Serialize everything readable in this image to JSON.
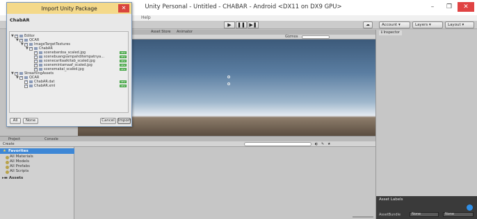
{
  "window": {
    "title": "Unity Personal - Untitled - CHABAR - Android <DX11 on DX9 GPU>",
    "minimize": "–",
    "maximize": "❐",
    "close": "✕"
  },
  "menu": {
    "help": "Help"
  },
  "toolbar": {
    "account": "Account",
    "layers": "Layers",
    "layout": "Layout"
  },
  "scene": {
    "tabs": [
      "Asset Store",
      "Animator"
    ],
    "gizmos": "Gizmos"
  },
  "inspector": {
    "tab": "Inspector",
    "asset_labels": "Asset Labels",
    "assetbundle_label": "AssetBundle",
    "assetbundle_value": "None",
    "assetbundle_variant": "None"
  },
  "project": {
    "tabs": [
      "Project",
      "Console"
    ],
    "create": "Create",
    "favorites": "Favorites",
    "favorite_items": [
      "All Materials",
      "All Models",
      "All Prefabs",
      "All Scripts"
    ],
    "assets": "Assets"
  },
  "dialog": {
    "title": "Import Unity Package",
    "package_name": "ChabAR",
    "tree": [
      {
        "label": "Editor",
        "depth": 0,
        "arrow": true
      },
      {
        "label": "QCAR",
        "depth": 1,
        "arrow": true
      },
      {
        "label": "ImageTargetTextures",
        "depth": 2,
        "arrow": true
      },
      {
        "label": "ChabAR",
        "depth": 3,
        "arrow": true
      },
      {
        "label": "scenebardoa_scaled.jpg",
        "depth": 4,
        "badge": true
      },
      {
        "label": "scenebuangsampahditempatnya...",
        "depth": 4,
        "badge": true
      },
      {
        "label": "scenecaritaalkitab_scaled.jpg",
        "depth": 4,
        "badge": true
      },
      {
        "label": "scenemintamaaf_scaled.jpg",
        "depth": 4,
        "badge": true
      },
      {
        "label": "scenemakal_scaled.jpg",
        "depth": 4,
        "badge": true
      },
      {
        "label": "StreamingAssets",
        "depth": 0,
        "arrow": true
      },
      {
        "label": "QCAR",
        "depth": 1,
        "arrow": true
      },
      {
        "label": "ChabAR.dat",
        "depth": 2,
        "badge": true
      },
      {
        "label": "ChabAR.xml",
        "depth": 2,
        "badge": true
      }
    ],
    "badge_text": "NEW",
    "buttons": {
      "all": "All",
      "none": "None",
      "cancel": "Cancel",
      "import": "Import"
    }
  },
  "colors": {
    "dialog_title_bg": "#f4d98a",
    "favorites_highlight": "#3d87d6",
    "new_badge": "#3ea33e",
    "close_red": "#e04343"
  }
}
